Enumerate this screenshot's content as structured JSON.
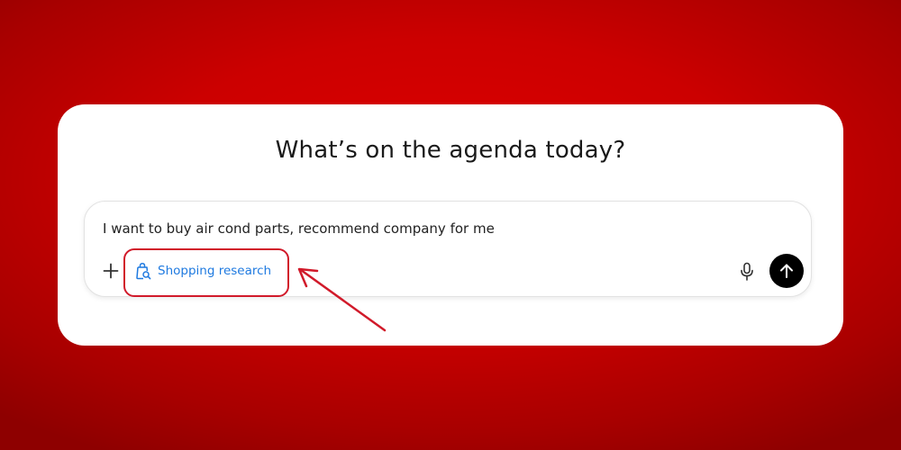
{
  "colors": {
    "background": "#cc0000",
    "card": "#ffffff",
    "accent": "#1f7ae0",
    "annotation": "#d11a2a",
    "send_button": "#000000"
  },
  "headline": "What’s on the agenda today?",
  "composer": {
    "prompt_text": "I want to buy air cond parts, recommend company for me",
    "tool_chip": {
      "label": "Shopping research",
      "icon": "shopping-bag-search-icon"
    },
    "icons": {
      "add": "plus-icon",
      "voice": "microphone-icon",
      "send": "arrow-up-icon"
    }
  }
}
